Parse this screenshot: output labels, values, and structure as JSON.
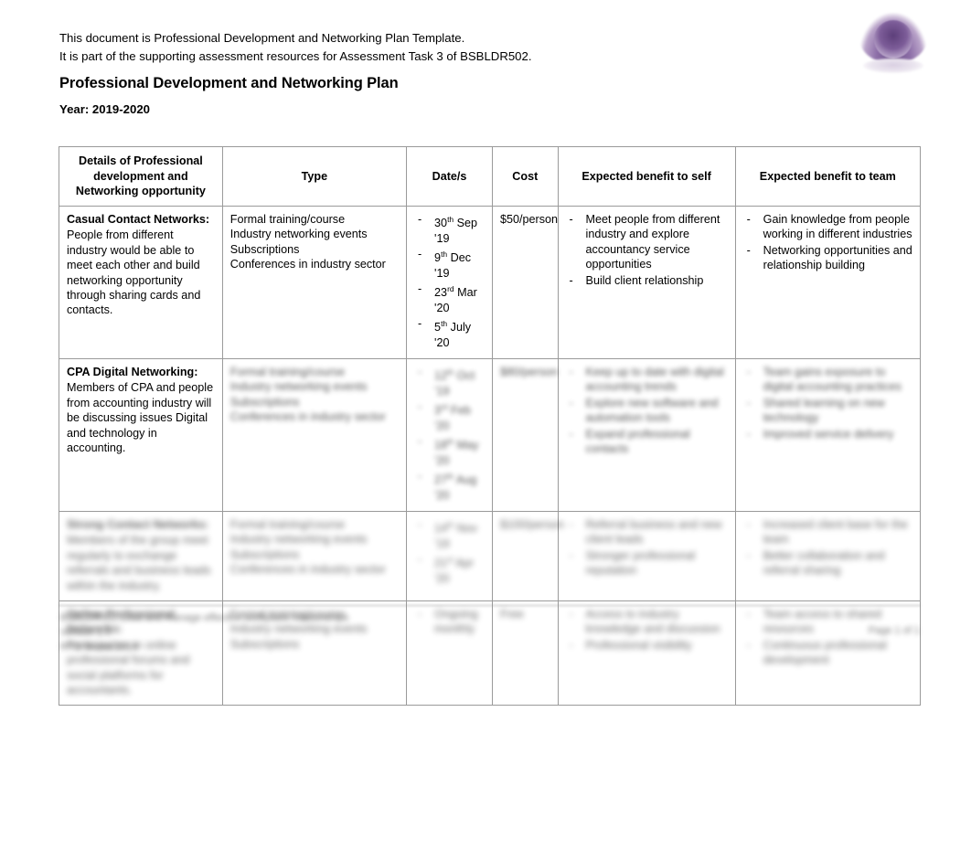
{
  "intro": {
    "line1": "This document is Professional Development and Networking Plan Template.",
    "line2": "It is part of the supporting assessment resources for Assessment Task 3 of BSBLDR502."
  },
  "document": {
    "title": "Professional Development and Networking Plan",
    "year_label": "Year: 2019-2020"
  },
  "table": {
    "headers": [
      "Details of Professional development and Networking opportunity",
      "Type",
      "Date/s",
      "Cost",
      "Expected benefit to self",
      "Expected benefit to team"
    ],
    "rows": [
      {
        "details_title": "Casual Contact Networks:",
        "details_text": "People from different industry would be able to meet each other and build networking opportunity through sharing cards and contacts.",
        "type": [
          "Formal training/course",
          "Industry networking events",
          "Subscriptions",
          "Conferences in industry sector"
        ],
        "dates": [
          "30th Sep '19",
          "9th Dec '19",
          "23rd Mar '20",
          "5th July '20"
        ],
        "cost": "$50/person",
        "benefit_self": [
          "Meet people from different industry and explore accountancy service opportunities",
          "Build client relationship"
        ],
        "benefit_team": [
          "Gain knowledge from people working in different industries",
          "Networking opportunities and relationship building"
        ]
      },
      {
        "details_title": "CPA Digital Networking:",
        "details_text": "Members of CPA and people from accounting industry will be discussing issues Digital and technology in accounting.",
        "type": [
          "Formal training/course",
          "Industry networking events",
          "Subscriptions",
          "Conferences in industry sector"
        ],
        "dates": [
          "12th Oct '19",
          "3rd Feb '20",
          "18th May '20",
          "27th Aug '20"
        ],
        "cost": "$80/person",
        "benefit_self": [
          "Keep up to date with digital accounting trends",
          "Explore new software and automation tools",
          "Expand professional contacts"
        ],
        "benefit_team": [
          "Team gains exposure to digital accounting practices",
          "Shared learning on new technology",
          "Improved service delivery"
        ]
      },
      {
        "details_title": "Strong Contact Networks:",
        "details_text": "Members of the group meet regularly to exchange referrals and business leads within the industry.",
        "type": [
          "Formal training/course",
          "Industry networking events",
          "Subscriptions",
          "Conferences in industry sector"
        ],
        "dates": [
          "14th Nov '19",
          "21st Apr '20"
        ],
        "cost": "$100/person",
        "benefit_self": [
          "Referral business and new client leads",
          "Stronger professional reputation"
        ],
        "benefit_team": [
          "Increased client base for the team",
          "Better collaboration and referral sharing"
        ]
      },
      {
        "details_title": "Online Professional Networks:",
        "details_text": "Participation in online professional forums and social platforms for accountants.",
        "type": [
          "Formal training/course",
          "Industry networking events",
          "Subscriptions"
        ],
        "dates": [
          "Ongoing monthly"
        ],
        "cost": "Free",
        "benefit_self": [
          "Access to industry knowledge and discussion",
          "Professional visibility"
        ],
        "benefit_team": [
          "Team access to shared resources",
          "Continuous professional development"
        ]
      }
    ]
  },
  "footer": {
    "line1": "BSBLDR502 Lead and manage effective workplace relationships",
    "line2": "Version 1.0",
    "line3": "RTO Works 2019",
    "page": "Page 1 of 1"
  }
}
